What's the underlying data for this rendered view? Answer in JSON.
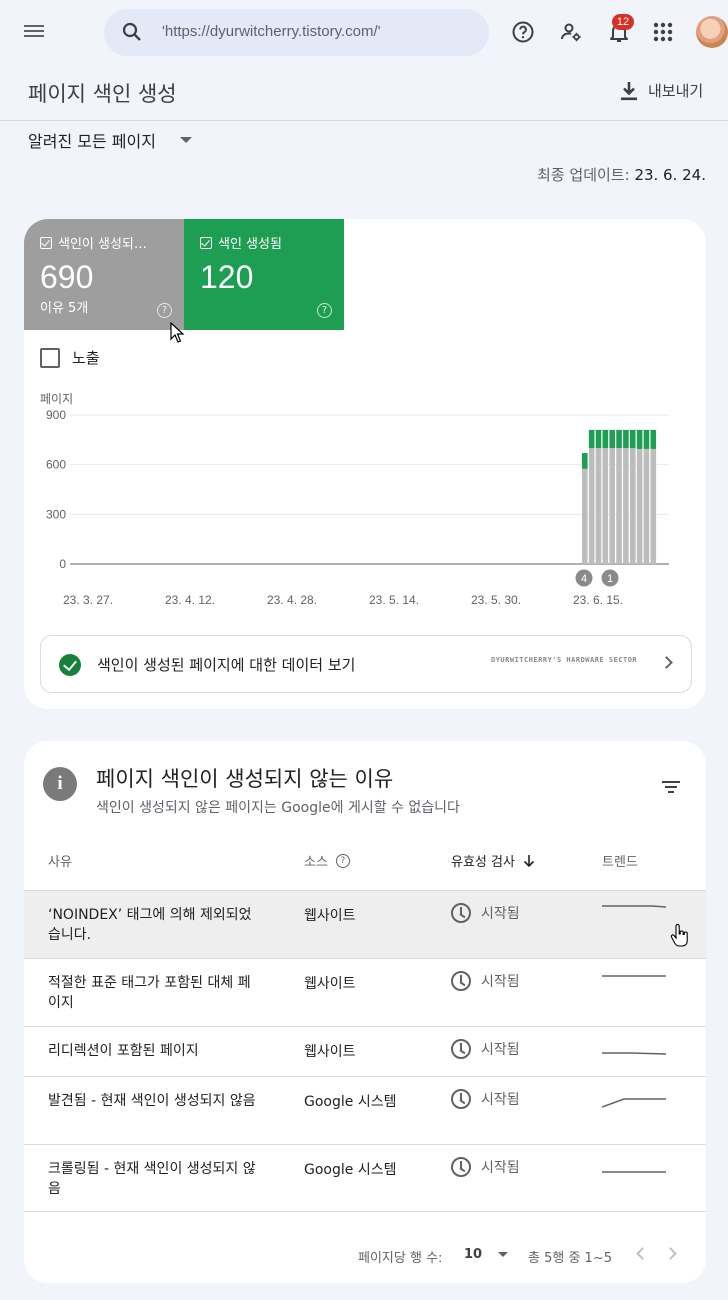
{
  "topbar": {
    "search_value": "'https://dyurwitcherry.tistory.com/'",
    "notification_count": "12"
  },
  "header": {
    "title": "페이지 색인 생성",
    "export_label": "내보내기"
  },
  "filter": {
    "selected": "알려진 모든 페이지"
  },
  "updated": {
    "label": "최종 업데이트:",
    "date": "23. 6. 24."
  },
  "tiles": {
    "not_indexed": {
      "label": "색인이 생성되…",
      "count": "690",
      "sub": "이유 5개"
    },
    "indexed": {
      "label": "색인 생성됨",
      "count": "120"
    }
  },
  "impressions_label": "노출",
  "chart_data": {
    "type": "bar",
    "ylabel": "페이지",
    "yticks": [
      "900",
      "600",
      "300",
      "0"
    ],
    "ylim": [
      0,
      900
    ],
    "xticks": [
      "23. 3. 27.",
      "23. 4. 12.",
      "23. 4. 28.",
      "23. 5. 14.",
      "23. 5. 30.",
      "23. 6. 15."
    ],
    "series": [
      {
        "values": [
          575,
          700,
          700,
          700,
          700,
          700,
          700,
          700,
          695,
          695,
          695
        ]
      },
      {
        "values": [
          95,
          110,
          110,
          110,
          110,
          110,
          110,
          110,
          115,
          115,
          115
        ]
      }
    ],
    "colors": [
      "#bdbdbd",
      "#1e9e52"
    ],
    "annotations": [
      "4",
      "1"
    ],
    "grid": true
  },
  "data_link": {
    "label": "색인이 생성된 페이지에 대한 데이터 보기",
    "watermark_line1": "DYURWITCHERRY'S HARDWARE SECTOR"
  },
  "reasons_card": {
    "title": "페이지 색인이 생성되지 않는 이유",
    "subtitle": "색인이 생성되지 않은 페이지는 Google에 게시할 수 없습니다",
    "columns": {
      "reason": "사유",
      "source": "소스",
      "validation": "유효성 검사",
      "trend": "트렌드"
    },
    "rows": [
      {
        "reason": "‘NOINDEX’ 태그에 의해 제외되었습니다.",
        "source": "웹사이트",
        "validation": "시작됨"
      },
      {
        "reason": "적절한 표준 태그가 포함된 대체 페이지",
        "source": "웹사이트",
        "validation": "시작됨"
      },
      {
        "reason": "리디렉션이 포함된 페이지",
        "source": "웹사이트",
        "validation": "시작됨"
      },
      {
        "reason": "발견됨 - 현재 색인이 생성되지 않음",
        "source": "Google 시스템",
        "validation": "시작됨"
      },
      {
        "reason": "크롤링됨 - 현재 색인이 생성되지 않음",
        "source": "Google 시스템",
        "validation": "시작됨"
      }
    ]
  },
  "pager": {
    "rows_label": "페이지당 행 수:",
    "rows_value": "10",
    "range": "총 5행 중 1~5"
  }
}
